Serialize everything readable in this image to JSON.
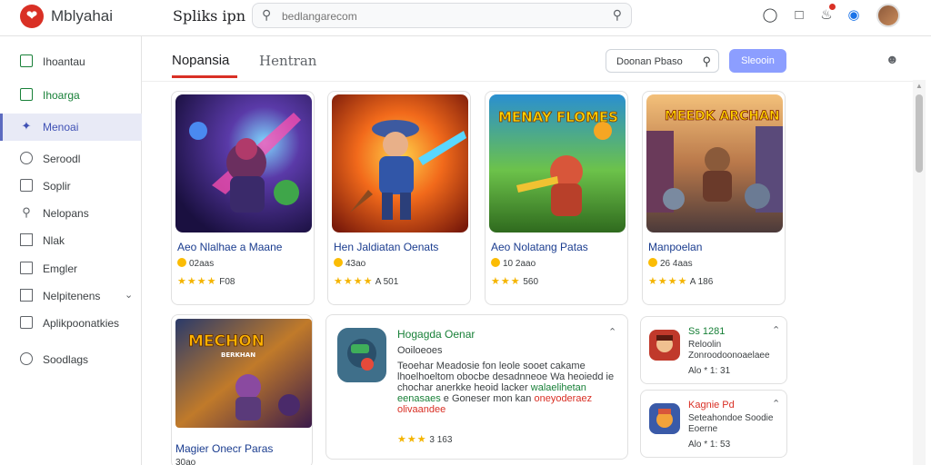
{
  "app": {
    "brand": "Mblyahai",
    "nav_title": "Spliks ipn",
    "search_placeholder": "bedlangarecom"
  },
  "sidebar": {
    "items": [
      {
        "label": "Ihoantau",
        "icon": "square-icon",
        "state": "normal"
      },
      {
        "label": "Ihoarga",
        "icon": "square-icon",
        "state": "green"
      },
      {
        "label": "Menoai",
        "icon": "tag-icon",
        "state": "active"
      },
      {
        "label": "Seroodl",
        "icon": "circle-icon",
        "state": "normal"
      },
      {
        "label": "Soplir",
        "icon": "square-icon",
        "state": "normal"
      },
      {
        "label": "Nelopans",
        "icon": "search-icon",
        "state": "normal"
      },
      {
        "label": "Nlak",
        "icon": "grid-icon",
        "state": "normal"
      },
      {
        "label": "Emgler",
        "icon": "bookmark-icon",
        "state": "normal"
      },
      {
        "label": "Nelpitenens",
        "icon": "grid-icon",
        "state": "normal",
        "chevron": true
      },
      {
        "label": "Aplikpoonatkies",
        "icon": "square-icon",
        "state": "normal"
      },
      {
        "label": "Soodlags",
        "icon": "circle-icon",
        "state": "normal"
      }
    ]
  },
  "main": {
    "tabs": [
      {
        "label": "Nopansia",
        "active": true
      },
      {
        "label": "Hentran",
        "active": false
      }
    ],
    "filter_label": "Doonan Pbaso",
    "primary_button": "Sleooin",
    "games": [
      {
        "title": "Aeo Nlalhae a Maane",
        "meta": "02aas",
        "rating": "F08"
      },
      {
        "title": "Hen Jaldiatan Oenats",
        "meta": "43ao",
        "rating": "A 501"
      },
      {
        "title": "Aeo Nolatang Patas",
        "meta": "10 2aao",
        "rating": "560"
      },
      {
        "title": "Manpoelan",
        "meta": "26 4aas",
        "rating": "A 186"
      }
    ],
    "lower_card": {
      "title": "Magier Onecr Paras",
      "meta": "30ao",
      "art_text": "MECHON",
      "art_sub": "BERKHAN"
    },
    "feature": {
      "title": "Hogagda  Oenar",
      "subtitle": "Ooiloeoes",
      "desc_1": "Teoehar Meadosie fon leole sooet cakame lhoelhoeltom obocbe desadnneoe Wa heoiedd ie chochar anerkke heoid lacker",
      "desc_green": "walaelihetan eenasaes",
      "desc_2": "e Goneser mon kan",
      "desc_orange": "oneyoderaez olivaandee",
      "rating": "3 163"
    },
    "side_cards": [
      {
        "title": "Ss 1281",
        "subtitle": "Reloolin Zonroodoonoaelaee",
        "rating": "Alo * 1: 31"
      },
      {
        "title": "Kagnie Pd",
        "subtitle": "Seteahondoe Soodie Eoerne",
        "rating": "Alo * 1: 53"
      }
    ],
    "art": {
      "card3": "MENAY FLOMES",
      "card4": "MEEDK ARCHAN"
    }
  },
  "colors": {
    "accent": "#d93025",
    "active_bg": "#e8eaf6",
    "primary_button": "#8c9eff",
    "link": "#1a3c8f",
    "green": "#188038",
    "star": "#f4b400"
  }
}
